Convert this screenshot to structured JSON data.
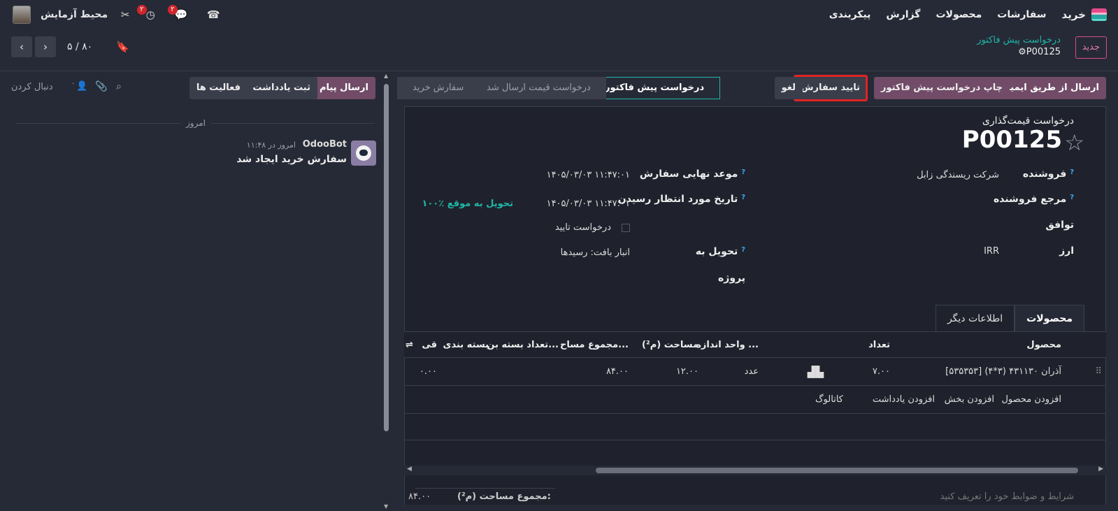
{
  "colors": {
    "accent": "#714b67",
    "teal": "#1fb6a8",
    "highlight": "#e02424",
    "background": "#262a36"
  },
  "topbar": {
    "app_name": "خرید",
    "menu": [
      "سفارشات",
      "محصولات",
      "گزارش",
      "پیکربندی"
    ],
    "company": "محیط آزمایش",
    "icons": [
      "tools-icon",
      "activity-clock-icon",
      "chat-bubbles-icon",
      "phone-icon"
    ],
    "badge_activity": "۲",
    "badge_messages": "۲"
  },
  "control": {
    "new_button": "جدید",
    "breadcrumb_parent": "درخواست پیش فاکتور",
    "record_name": "P00125",
    "pager": "۵ / ۸۰"
  },
  "actions": {
    "send_email": "ارسال از طریق ایمیل",
    "print_rfq": "چاپ درخواست پیش فاکتور",
    "confirm_order": "تایید سفارش",
    "cancel": "لغو"
  },
  "statusbar": [
    "درخواست پیش فاکتور",
    "درخواست قیمت ارسال شد",
    "سفارش خرید"
  ],
  "form": {
    "type_label": "درخواست قیمت‌گذاری",
    "name": "P00125",
    "vendor_label": "فروشنده",
    "vendor_value": "شرکت ریسندگی زابل",
    "vendor_ref_label": "مرجع فروشنده",
    "agreement_label": "توافق",
    "currency_label": "ارز",
    "currency_value": "IRR",
    "deadline_label": "موعد نهایی سفارش",
    "deadline_value": "۱۴۰۵/۰۳/۰۳ ۱۱:۴۷:۰۱",
    "expected_label": "تاریخ مورد انتظار رسیدن",
    "expected_value": "۱۴۰۵/۰۳/۰۳ ۱۱:۴۷:۰۱",
    "on_time": "۱۰۰٪ تحویل به موقع",
    "ack_label": "درخواست تایید",
    "deliver_label": "تحویل به",
    "deliver_value": "انبار بافت: رسیدها",
    "project_label": "پروژه"
  },
  "tabs": [
    "محصولات",
    "اطلاعات دیگر"
  ],
  "table": {
    "columns": [
      "محصول",
      "تعداد",
      "واحد اندازه ...",
      "مساحت (م²)",
      "مجموع مساح...",
      "تعداد بسته بن...",
      "بسته بندی",
      "قی"
    ],
    "rows": [
      {
        "product": "[۵۳۵۳۵۳] آذران ۴۳۱۱۳۰ (۳*۴)",
        "qty": "۷.۰۰",
        "uom": "عدد",
        "area": "۱۲.۰۰",
        "total_area": "۸۴.۰۰",
        "price": "۰.۰۰"
      }
    ],
    "add_links": [
      "افزودن محصول",
      "افزودن بخش",
      "افزودن یادداشت",
      "کاتالوگ"
    ]
  },
  "footer": {
    "terms_placeholder": "شرایط و ضوابط خود را تعریف کنید",
    "total_area_label": "مجموع مساحت (م²):",
    "total_area_value": "۸۴.۰۰"
  },
  "chatter": {
    "send_message": "ارسال پیام",
    "log_note": "ثبت یادداشت",
    "activities": "فعالیت ها",
    "follow": "دنبال کردن",
    "followers_count": "۰",
    "today": "امروز",
    "author": "OdooBot",
    "time": "امروز در ۱۱:۴۸",
    "message": "سفارش خرید ایجاد شد"
  }
}
